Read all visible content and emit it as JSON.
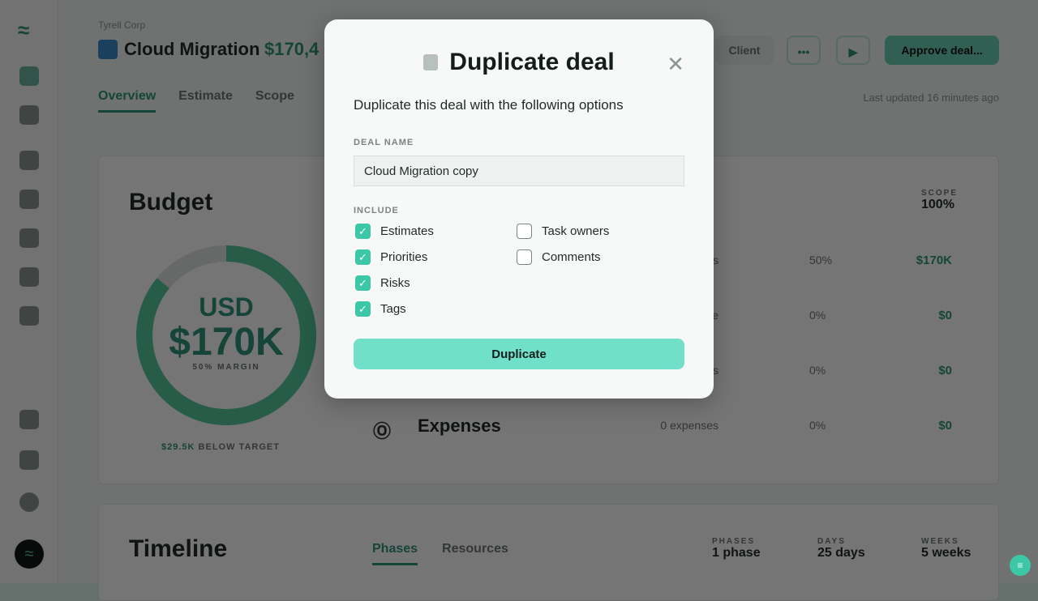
{
  "background": {
    "company": "Tyrell Corp",
    "deal_title": "Cloud Migration",
    "deal_amount": "$170,4",
    "tabs": [
      "Overview",
      "Estimate",
      "Scope"
    ],
    "client_button": "Client",
    "more_button": "•••",
    "play_button": "▶",
    "approve_button": "Approve deal...",
    "last_updated": "Last updated 16 minutes ago",
    "budget": {
      "title": "Budget",
      "currency": "USD",
      "amount": "$170K",
      "margin": "50% MARGIN",
      "margin_value": 0.5,
      "below_target_amount": "$29.5K",
      "below_target_label": "BELOW TARGET",
      "scope_label": "SCOPE",
      "scope_value": "100%",
      "rows": [
        {
          "label": "",
          "detail": "es",
          "percent": "50%",
          "amount": "$170K"
        },
        {
          "label": "",
          "detail": "e",
          "percent": "0%",
          "amount": "$0"
        },
        {
          "label": "",
          "detail": "s",
          "percent": "0%",
          "amount": "$0"
        },
        {
          "label": "Expenses",
          "detail": "0 expenses",
          "percent": "0%",
          "amount": "$0"
        }
      ]
    },
    "timeline": {
      "title": "Timeline",
      "tabs": [
        "Phases",
        "Resources"
      ],
      "stats": [
        {
          "label": "PHASES",
          "value": "1 phase"
        },
        {
          "label": "DAYS",
          "value": "25 days"
        },
        {
          "label": "WEEKS",
          "value": "5 weeks"
        }
      ]
    }
  },
  "modal": {
    "title": "Duplicate deal",
    "description": "Duplicate this deal with the following options",
    "deal_name_label": "DEAL NAME",
    "deal_name_value": "Cloud Migration copy",
    "include_label": "INCLUDE",
    "options": [
      {
        "label": "Estimates",
        "checked": true
      },
      {
        "label": "Priorities",
        "checked": true
      },
      {
        "label": "Risks",
        "checked": true
      },
      {
        "label": "Tags",
        "checked": true
      },
      {
        "label": "Task owners",
        "checked": false
      },
      {
        "label": "Comments",
        "checked": false
      }
    ],
    "submit_label": "Duplicate"
  },
  "colors": {
    "accent": "#3cc7a7",
    "button": "#70e0c8",
    "brand_green": "#1a9c7a"
  }
}
